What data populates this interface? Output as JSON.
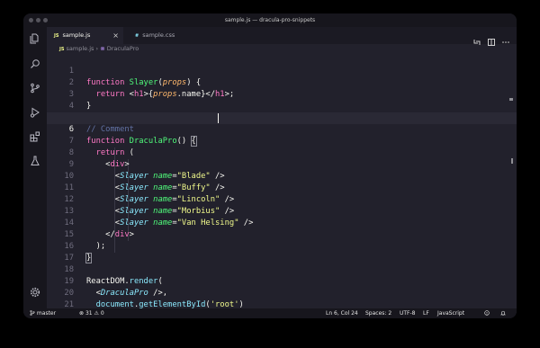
{
  "window": {
    "title": "sample.js — dracula-pro-snippets"
  },
  "activity_bar": {
    "icons": [
      "files-icon",
      "search-icon",
      "source-control-icon",
      "run-debug-icon",
      "extensions-icon",
      "flask-icon",
      "settings-gear-icon"
    ]
  },
  "tabs": [
    {
      "icon": "JS",
      "label": "sample.js",
      "active": true,
      "close": "×"
    },
    {
      "icon": "#",
      "label": "sample.css",
      "active": false
    }
  ],
  "breadcrumb": {
    "icon": "JS",
    "file": "sample.js",
    "separator": "›",
    "symbol": "DraculaPro"
  },
  "editor": {
    "current_line": 6,
    "lines": [
      {
        "n": "1",
        "text": "function Slayer(props) {"
      },
      {
        "n": "2",
        "text": "  return <h1>{props.name}</h1>;"
      },
      {
        "n": "3",
        "text": "}"
      },
      {
        "n": "4",
        "text": ""
      },
      {
        "n": "5",
        "text": "// Comment"
      },
      {
        "n": "6",
        "text": "function DraculaPro() {"
      },
      {
        "n": "7",
        "text": "  return ("
      },
      {
        "n": "8",
        "text": "    <div>"
      },
      {
        "n": "9",
        "text": "      <Slayer name=\"Blade\" />"
      },
      {
        "n": "10",
        "text": "      <Slayer name=\"Buffy\" />"
      },
      {
        "n": "11",
        "text": "      <Slayer name=\"Lincoln\" />"
      },
      {
        "n": "12",
        "text": "      <Slayer name=\"Morbius\" />"
      },
      {
        "n": "13",
        "text": "      <Slayer name=\"Van Helsing\" />"
      },
      {
        "n": "14",
        "text": "    </div>"
      },
      {
        "n": "15",
        "text": "  );"
      },
      {
        "n": "16",
        "text": "}"
      },
      {
        "n": "17",
        "text": ""
      },
      {
        "n": "18",
        "text": "ReactDOM.render("
      },
      {
        "n": "19",
        "text": "  <DraculaPro />,"
      },
      {
        "n": "20",
        "text": "  document.getElementById('root')"
      },
      {
        "n": "21",
        "text": ");"
      }
    ]
  },
  "status": {
    "branch": "master",
    "errors": "31",
    "warnings": "0",
    "position": "Ln 6, Col 24",
    "spaces": "Spaces: 2",
    "encoding": "UTF-8",
    "eol": "LF",
    "language": "JavaScript"
  },
  "colors": {
    "background": "#22212c",
    "chrome": "#17161d",
    "pink": "#ff79c6",
    "green": "#50fa7b",
    "cyan": "#8be9fd",
    "orange": "#ffb86c",
    "yellow": "#f1fa8c",
    "comment": "#6272a4",
    "foreground": "#f8f8f2"
  }
}
